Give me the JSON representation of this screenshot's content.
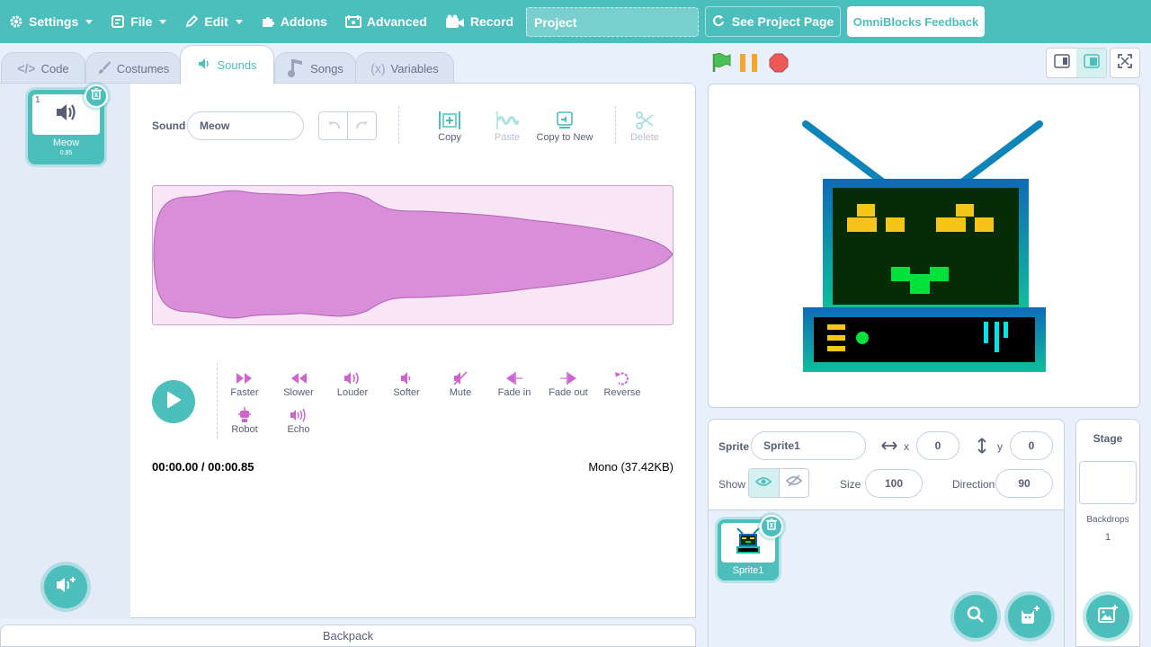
{
  "menu": {
    "settings": "Settings",
    "file": "File",
    "edit": "Edit",
    "addons": "Addons",
    "advanced": "Advanced",
    "record": "Record",
    "project_title": "Project",
    "see_project_page": "See Project Page",
    "feedback": "OmniBlocks Feedback"
  },
  "tabs": [
    {
      "label": "Code",
      "icon": "code-icon"
    },
    {
      "label": "Costumes",
      "icon": "brush-icon"
    },
    {
      "label": "Sounds",
      "icon": "speaker-icon",
      "active": true
    },
    {
      "label": "Songs",
      "icon": "music-note-icon"
    },
    {
      "label": "Variables",
      "icon": "variable-icon"
    }
  ],
  "sound_list": {
    "items": [
      {
        "index": "1",
        "name": "Meow",
        "duration": "0.85"
      }
    ]
  },
  "editor": {
    "sound_label": "Sound",
    "sound_name": "Meow",
    "tools": {
      "copy": "Copy",
      "paste": "Paste",
      "copy_to_new": "Copy to New",
      "delete": "Delete"
    },
    "effects": {
      "faster": "Faster",
      "slower": "Slower",
      "louder": "Louder",
      "softer": "Softer",
      "mute": "Mute",
      "fade_in": "Fade in",
      "fade_out": "Fade out",
      "reverse": "Reverse",
      "robot": "Robot",
      "echo": "Echo"
    },
    "time": "00:00.00 / 00:00.85",
    "format": "Mono (37.42KB)",
    "waveform_color": "#d98fd8"
  },
  "backpack": "Backpack",
  "sprite_info": {
    "sprite_label": "Sprite",
    "sprite_name": "Sprite1",
    "x_label": "x",
    "x": "0",
    "y_label": "y",
    "y": "0",
    "show_label": "Show",
    "size_label": "Size",
    "size": "100",
    "direction_label": "Direction",
    "direction": "90"
  },
  "sprites": [
    {
      "name": "Sprite1"
    }
  ],
  "stage_target": {
    "title": "Stage",
    "backdrops_label": "Backdrops",
    "backdrops_count": "1"
  },
  "colors": {
    "accent": "#4cbfbd",
    "sound_purple": "#cf63cf",
    "flag_green": "#45993d",
    "pause_orange": "#f5a623",
    "stop_red": "#ec5959"
  }
}
